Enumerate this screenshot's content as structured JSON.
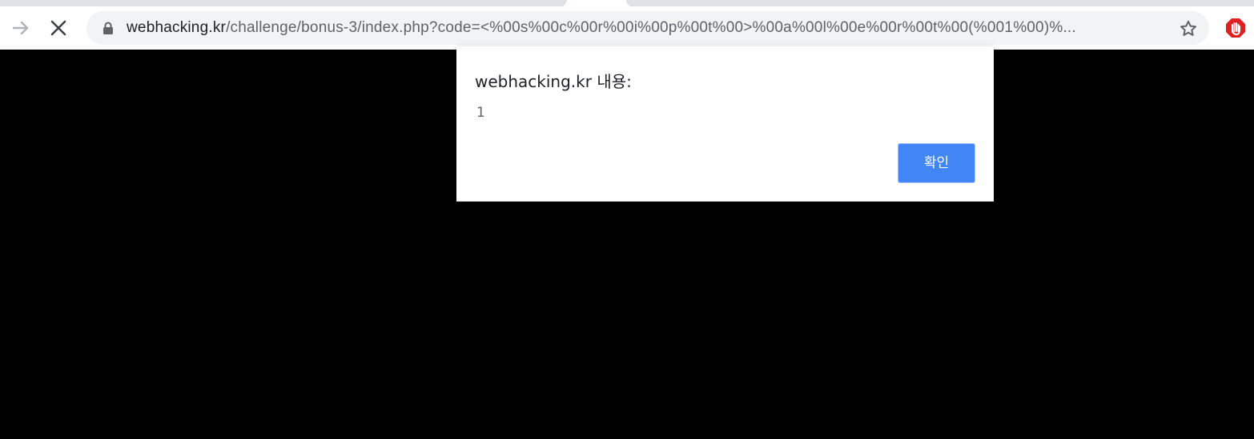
{
  "browser": {
    "url_host": "webhacking.kr",
    "url_rest": "/challenge/bonus-3/index.php?code=<%00s%00c%00r%00i%00p%00t%00>%00a%00l%00e%00r%00t%00(%001%00)%...",
    "icons": {
      "forward": "forward-arrow-icon",
      "stop": "stop-loading-icon",
      "lock": "lock-icon",
      "bookmark": "star-icon",
      "extension": "adblock-stop-icon"
    },
    "colors": {
      "tabstrip": "#dee1e6",
      "omnibox": "#f1f3f4",
      "extension_red": "#e02020"
    }
  },
  "alert": {
    "title": "webhacking.kr 내용:",
    "message": "1",
    "ok_label": "확인",
    "ok_color": "#4285f4"
  },
  "page": {
    "background": "#000000"
  }
}
